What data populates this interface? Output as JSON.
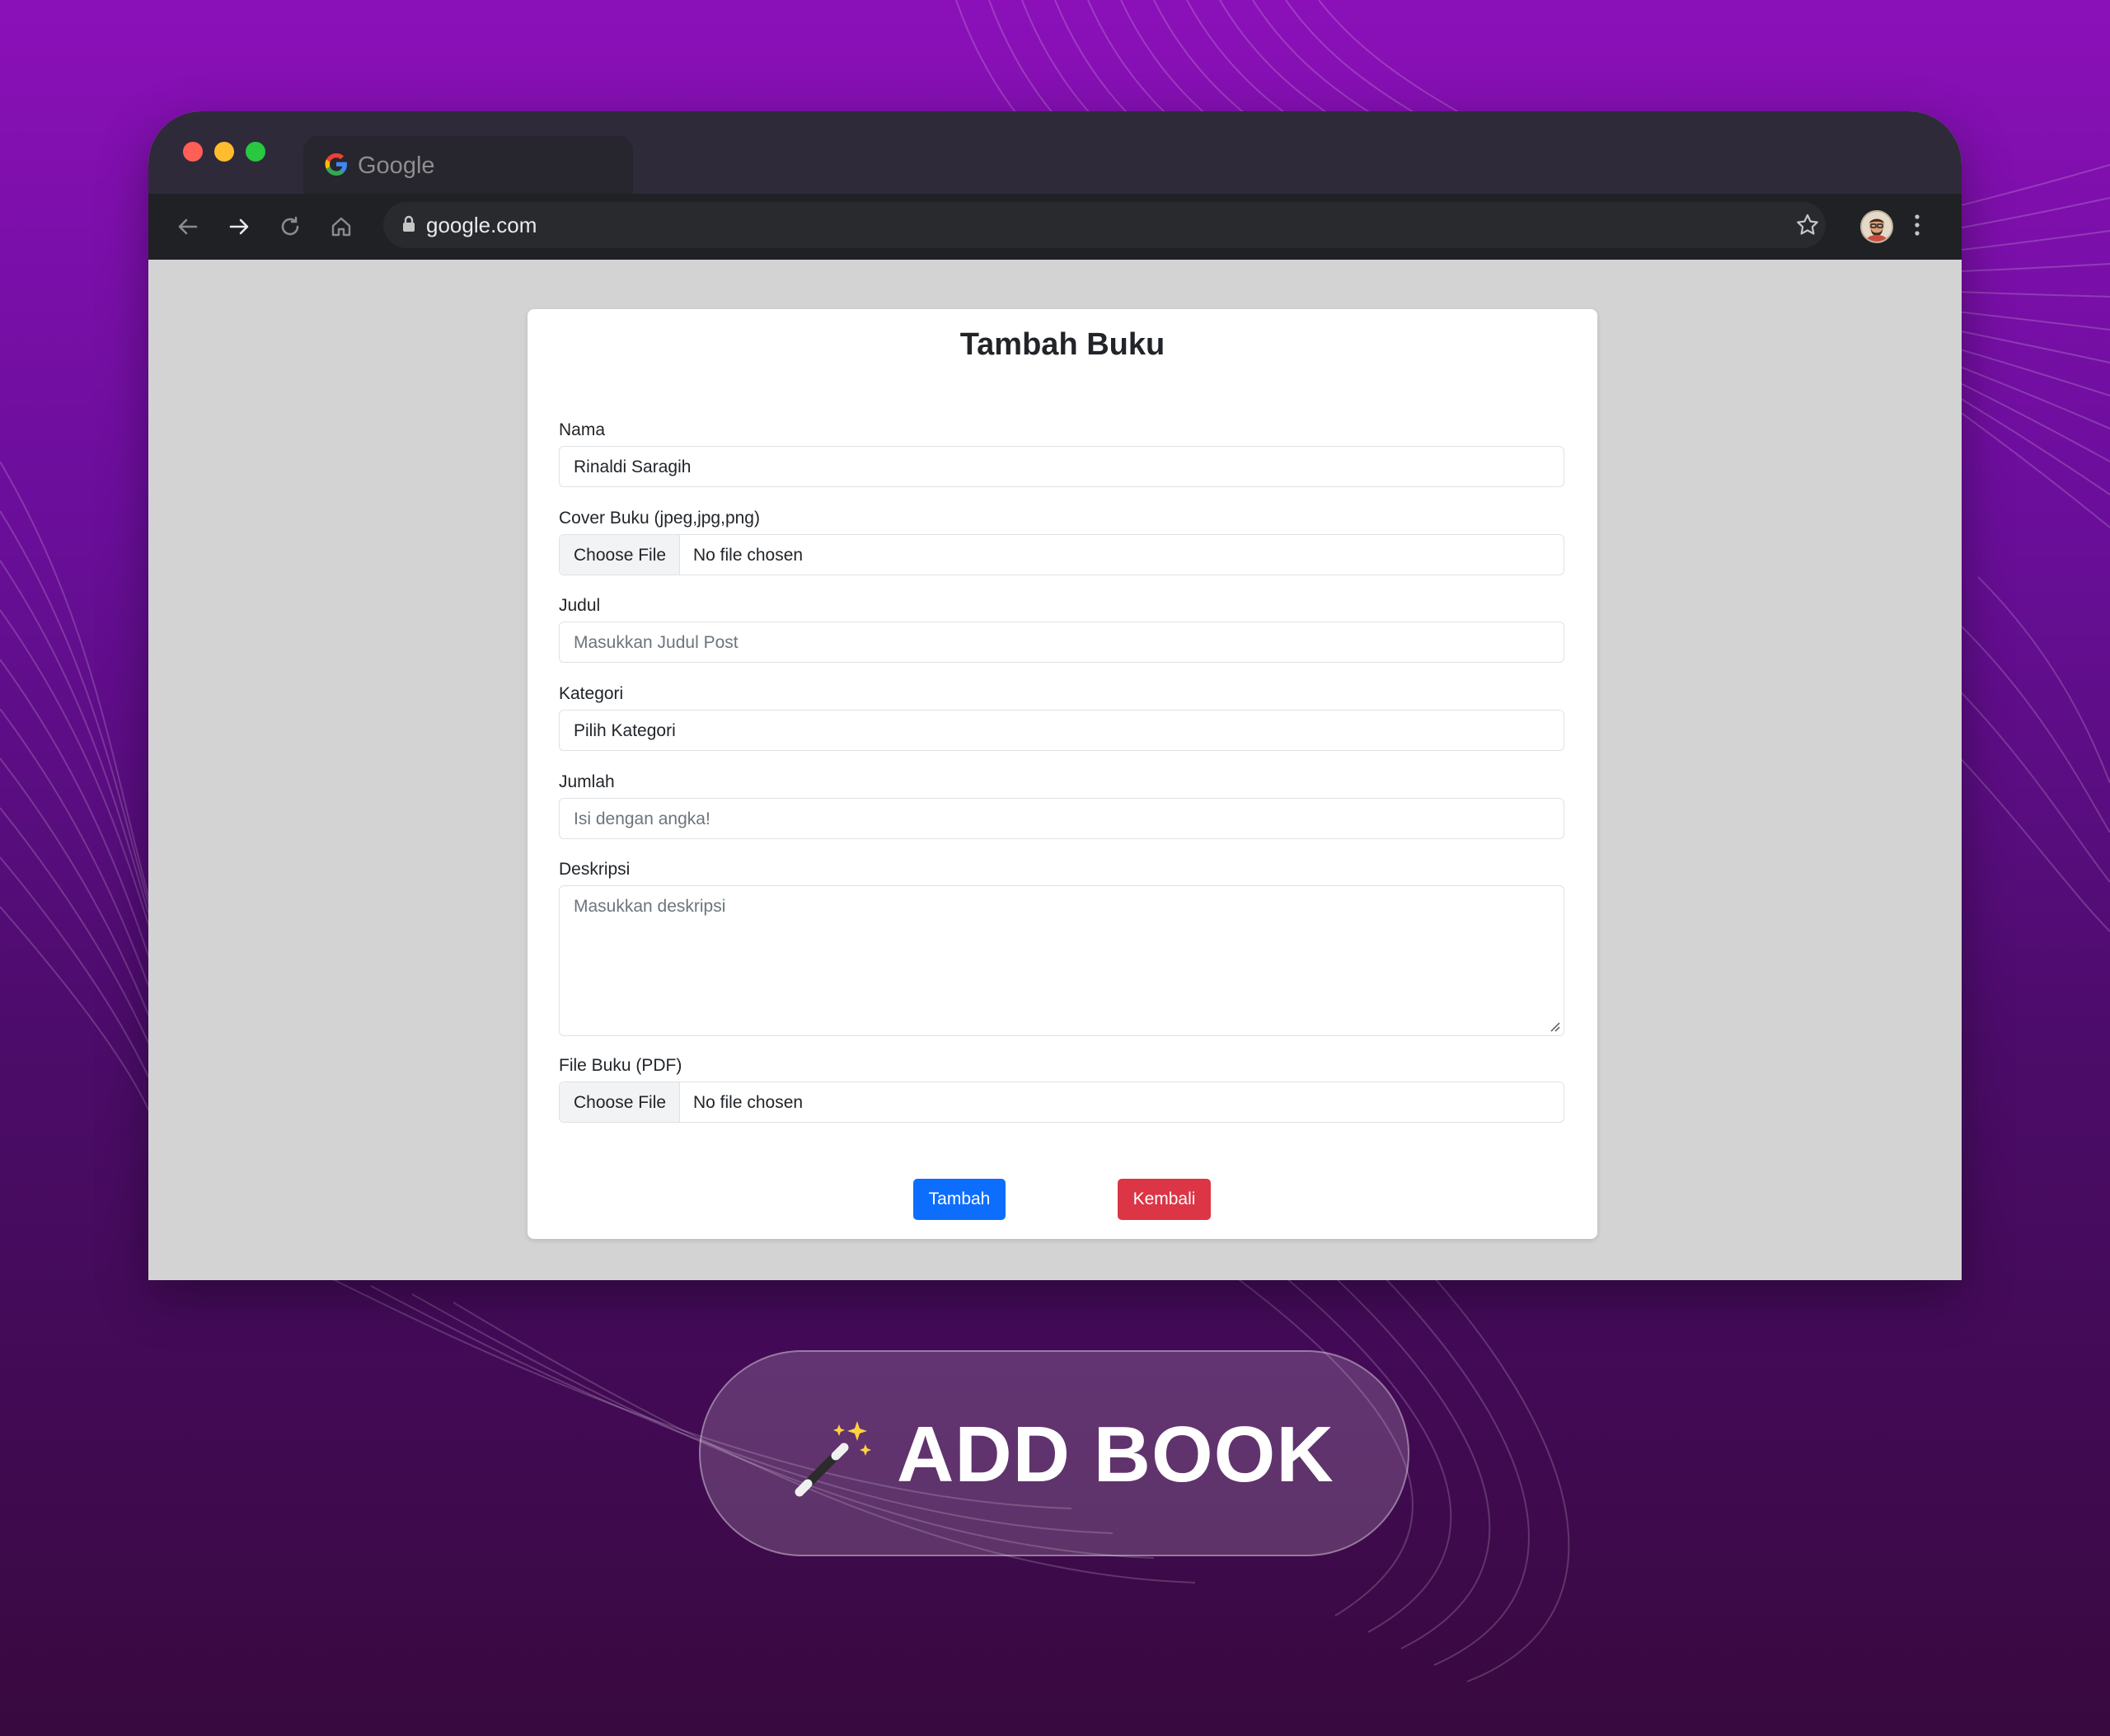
{
  "browser": {
    "tab_title": "Google",
    "url": "google.com"
  },
  "form": {
    "title": "Tambah Buku",
    "fields": {
      "nama": {
        "label": "Nama",
        "value": "Rinaldi Saragih"
      },
      "cover": {
        "label": "Cover Buku (jpeg,jpg,png)",
        "button": "Choose File",
        "status": "No file chosen"
      },
      "judul": {
        "label": "Judul",
        "placeholder": "Masukkan Judul Post"
      },
      "kategori": {
        "label": "Kategori",
        "value": "Pilih Kategori"
      },
      "jumlah": {
        "label": "Jumlah",
        "placeholder": "Isi dengan angka!"
      },
      "deskripsi": {
        "label": "Deskripsi",
        "placeholder": "Masukkan deskripsi"
      },
      "file_pdf": {
        "label": "File Buku (PDF)",
        "button": "Choose File",
        "status": "No file chosen"
      }
    },
    "buttons": {
      "submit": "Tambah",
      "back": "Kembali"
    }
  },
  "banner": {
    "text": "ADD BOOK",
    "icon": "magic-wand-icon"
  },
  "colors": {
    "primary": "#0d6efd",
    "danger": "#dc3545",
    "background_top": "#8b10b8",
    "background_bottom": "#38093f"
  }
}
